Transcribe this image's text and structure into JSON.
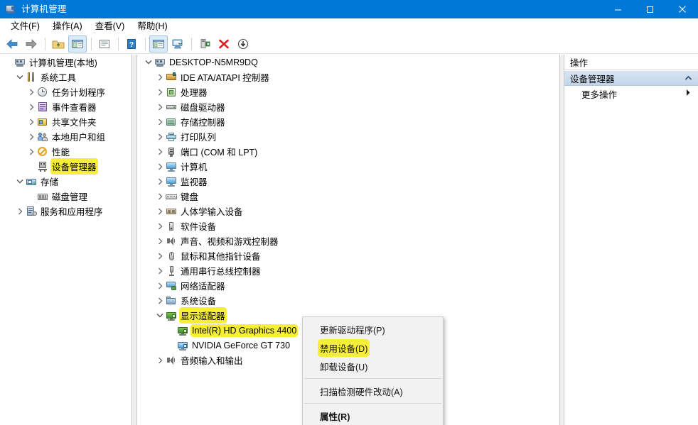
{
  "window": {
    "title": "计算机管理",
    "icon": "computer-management-icon",
    "minimize_label": "最小化",
    "maximize_label": "最大化",
    "close_label": "关闭",
    "titlebar_color": "#0078d7"
  },
  "menubar": {
    "items": [
      {
        "label": "文件(F)",
        "name": "menu-file"
      },
      {
        "label": "操作(A)",
        "name": "menu-action"
      },
      {
        "label": "查看(V)",
        "name": "menu-view"
      },
      {
        "label": "帮助(H)",
        "name": "menu-help"
      }
    ]
  },
  "toolbar": {
    "buttons": [
      {
        "name": "back-icon",
        "tooltip": "后退"
      },
      {
        "name": "forward-icon",
        "tooltip": "前进"
      },
      {
        "name": "up-folder-icon",
        "tooltip": "向上"
      },
      {
        "name": "show-hide-tree-icon",
        "tooltip": "显示/隐藏控制台树",
        "pressed": true
      },
      {
        "name": "properties-icon",
        "tooltip": "属性"
      },
      {
        "name": "help-icon",
        "tooltip": "帮助"
      },
      {
        "name": "show-action-pane-icon",
        "tooltip": "显示/隐藏操作窗格",
        "pressed": true
      },
      {
        "name": "scan-hardware-icon",
        "tooltip": "扫描检测硬件改动"
      },
      {
        "name": "update-driver-icon",
        "tooltip": "更新驱动程序"
      },
      {
        "name": "uninstall-device-icon",
        "tooltip": "卸载设备"
      },
      {
        "name": "disable-device-icon",
        "tooltip": "禁用设备"
      }
    ]
  },
  "sidebar": {
    "items": [
      {
        "label": "计算机管理(本地)",
        "icon": "computer-management-icon",
        "indent": 0,
        "chevron": "none",
        "highlight": false
      },
      {
        "label": "系统工具",
        "icon": "system-tools-icon",
        "indent": 1,
        "chevron": "down",
        "highlight": false
      },
      {
        "label": "任务计划程序",
        "icon": "task-scheduler-icon",
        "indent": 2,
        "chevron": "right",
        "highlight": false
      },
      {
        "label": "事件查看器",
        "icon": "event-viewer-icon",
        "indent": 2,
        "chevron": "right",
        "highlight": false
      },
      {
        "label": "共享文件夹",
        "icon": "shared-folders-icon",
        "indent": 2,
        "chevron": "right",
        "highlight": false
      },
      {
        "label": "本地用户和组",
        "icon": "local-users-groups-icon",
        "indent": 2,
        "chevron": "right",
        "highlight": false
      },
      {
        "label": "性能",
        "icon": "performance-icon",
        "indent": 2,
        "chevron": "right",
        "highlight": false
      },
      {
        "label": "设备管理器",
        "icon": "device-manager-icon",
        "indent": 2,
        "chevron": "none",
        "highlight": true
      },
      {
        "label": "存储",
        "icon": "storage-icon",
        "indent": 1,
        "chevron": "down",
        "highlight": false
      },
      {
        "label": "磁盘管理",
        "icon": "disk-management-icon",
        "indent": 2,
        "chevron": "none",
        "highlight": false
      },
      {
        "label": "服务和应用程序",
        "icon": "services-applications-icon",
        "indent": 1,
        "chevron": "right",
        "highlight": false
      }
    ]
  },
  "device_tree": {
    "items": [
      {
        "label": "DESKTOP-N5MR9DQ",
        "icon": "computer-root-icon",
        "indent": 0,
        "chevron": "down",
        "highlight": false
      },
      {
        "label": "IDE ATA/ATAPI 控制器",
        "icon": "ide-controller-icon",
        "indent": 1,
        "chevron": "right",
        "highlight": false
      },
      {
        "label": "处理器",
        "icon": "processor-icon",
        "indent": 1,
        "chevron": "right",
        "highlight": false
      },
      {
        "label": "磁盘驱动器",
        "icon": "disk-drive-icon",
        "indent": 1,
        "chevron": "right",
        "highlight": false
      },
      {
        "label": "存储控制器",
        "icon": "storage-controller-icon",
        "indent": 1,
        "chevron": "right",
        "highlight": false
      },
      {
        "label": "打印队列",
        "icon": "print-queue-icon",
        "indent": 1,
        "chevron": "right",
        "highlight": false
      },
      {
        "label": "端口 (COM 和 LPT)",
        "icon": "ports-icon",
        "indent": 1,
        "chevron": "right",
        "highlight": false
      },
      {
        "label": "计算机",
        "icon": "computer-icon",
        "indent": 1,
        "chevron": "right",
        "highlight": false
      },
      {
        "label": "监视器",
        "icon": "monitor-icon",
        "indent": 1,
        "chevron": "right",
        "highlight": false
      },
      {
        "label": "键盘",
        "icon": "keyboard-icon",
        "indent": 1,
        "chevron": "right",
        "highlight": false
      },
      {
        "label": "人体学输入设备",
        "icon": "hid-icon",
        "indent": 1,
        "chevron": "right",
        "highlight": false
      },
      {
        "label": "软件设备",
        "icon": "software-device-icon",
        "indent": 1,
        "chevron": "right",
        "highlight": false
      },
      {
        "label": "声音、视频和游戏控制器",
        "icon": "sound-video-game-icon",
        "indent": 1,
        "chevron": "right",
        "highlight": false
      },
      {
        "label": "鼠标和其他指针设备",
        "icon": "mouse-icon",
        "indent": 1,
        "chevron": "right",
        "highlight": false
      },
      {
        "label": "通用串行总线控制器",
        "icon": "usb-controller-icon",
        "indent": 1,
        "chevron": "right",
        "highlight": false
      },
      {
        "label": "网络适配器",
        "icon": "network-adapter-icon",
        "indent": 1,
        "chevron": "right",
        "highlight": false
      },
      {
        "label": "系统设备",
        "icon": "system-device-icon",
        "indent": 1,
        "chevron": "right",
        "highlight": false
      },
      {
        "label": "显示适配器",
        "icon": "display-adapter-icon",
        "indent": 1,
        "chevron": "down",
        "highlight": true
      },
      {
        "label": "Intel(R) HD Graphics 4400",
        "icon": "intel-gpu-icon",
        "indent": 2,
        "chevron": "none",
        "highlight": true
      },
      {
        "label": "NVIDIA GeForce GT 730",
        "icon": "nvidia-gpu-icon",
        "indent": 2,
        "chevron": "none",
        "highlight": false
      },
      {
        "label": "音频输入和输出",
        "icon": "audio-io-icon",
        "indent": 1,
        "chevron": "right",
        "highlight": false
      }
    ]
  },
  "actions_panel": {
    "header": "操作",
    "section": "设备管理器",
    "collapse_icon": "chevron-up-icon",
    "items": [
      {
        "label": "更多操作",
        "submenu_icon": "chevron-right-icon"
      }
    ]
  },
  "context_menu": {
    "items": [
      {
        "label": "更新驱动程序(P)",
        "name": "ctx-update-driver",
        "highlight": false,
        "bold": false,
        "separator_after": false
      },
      {
        "label": "禁用设备(D)",
        "name": "ctx-disable-device",
        "highlight": true,
        "bold": false,
        "separator_after": false
      },
      {
        "label": "卸载设备(U)",
        "name": "ctx-uninstall-device",
        "highlight": false,
        "bold": false,
        "separator_after": true
      },
      {
        "label": "扫描检测硬件改动(A)",
        "name": "ctx-scan-hardware",
        "highlight": false,
        "bold": false,
        "separator_after": true
      },
      {
        "label": "属性(R)",
        "name": "ctx-properties",
        "highlight": false,
        "bold": true,
        "separator_after": false
      }
    ]
  },
  "colors": {
    "highlight_yellow": "#f7ee3a",
    "titlebar_blue": "#0078d7",
    "section_blue": "#c3d5ea"
  }
}
